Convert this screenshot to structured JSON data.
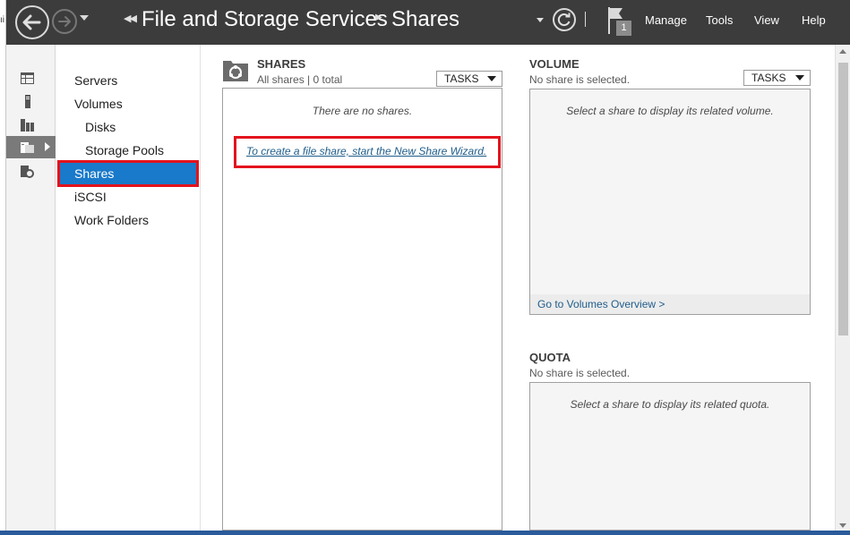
{
  "window": {
    "left_edge_text": "ıi"
  },
  "header": {
    "breadcrumb_root": "File and Storage Services",
    "breadcrumb_current": "Shares",
    "notification_count": "1",
    "menu": [
      "Manage",
      "Tools",
      "View",
      "Help"
    ]
  },
  "rail": {
    "items": [
      "dashboard-icon",
      "local-server-icon",
      "all-servers-icon",
      "file-storage-icon",
      "storage-services-icon"
    ]
  },
  "nav": {
    "items": [
      {
        "label": "Servers",
        "level": 0,
        "selected": false
      },
      {
        "label": "Volumes",
        "level": 0,
        "selected": false
      },
      {
        "label": "Disks",
        "level": 1,
        "selected": false
      },
      {
        "label": "Storage Pools",
        "level": 1,
        "selected": false
      },
      {
        "label": "Shares",
        "level": 0,
        "selected": true
      },
      {
        "label": "iSCSI",
        "level": 0,
        "selected": false
      },
      {
        "label": "Work Folders",
        "level": 0,
        "selected": false
      }
    ]
  },
  "shares": {
    "title": "SHARES",
    "subtitle": "All shares | 0 total",
    "tasks_label": "TASKS",
    "empty_message": "There are no shares.",
    "wizard_link": "To create a file share, start the New Share Wizard."
  },
  "volume": {
    "title": "VOLUME",
    "subtitle": "No share is selected.",
    "tasks_label": "TASKS",
    "empty_message": "Select a share to display its related volume.",
    "footer_link": "Go to Volumes Overview >"
  },
  "quota": {
    "title": "QUOTA",
    "subtitle": "No share is selected.",
    "empty_message": "Select a share to display its related quota."
  },
  "colors": {
    "header_bg": "#3c3c3c",
    "selection_blue": "#1979ca",
    "highlight_red": "#e3131d",
    "link_blue": "#1f5d8b"
  }
}
